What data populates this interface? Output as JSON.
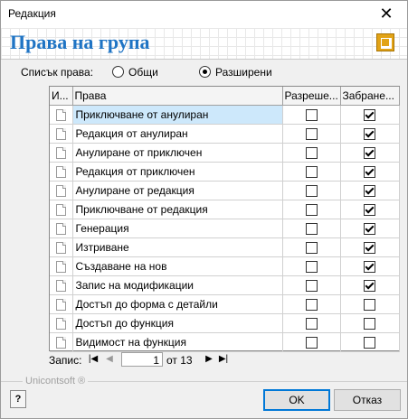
{
  "window": {
    "title": "Редакция",
    "close_glyph": "✕"
  },
  "header": {
    "title": "Права на група",
    "logo_icon": "app-logo-icon"
  },
  "rights_list": {
    "label": "Списък права:",
    "options": [
      {
        "label": "Общи",
        "selected": false
      },
      {
        "label": "Разширени",
        "selected": true
      }
    ]
  },
  "table": {
    "columns": [
      "И...",
      "Права",
      "Разреше...",
      "Забране..."
    ],
    "rows": [
      {
        "name": "Приключване от анулиран",
        "allowed": false,
        "denied": true,
        "selected": true
      },
      {
        "name": "Редакция от анулиран",
        "allowed": false,
        "denied": true,
        "selected": false
      },
      {
        "name": "Анулиране от приключен",
        "allowed": false,
        "denied": true,
        "selected": false
      },
      {
        "name": "Редакция от приключен",
        "allowed": false,
        "denied": true,
        "selected": false
      },
      {
        "name": "Анулиране от редакция",
        "allowed": false,
        "denied": true,
        "selected": false
      },
      {
        "name": "Приключване от редакция",
        "allowed": false,
        "denied": true,
        "selected": false
      },
      {
        "name": "Генерация",
        "allowed": false,
        "denied": true,
        "selected": false
      },
      {
        "name": "Изтриване",
        "allowed": false,
        "denied": true,
        "selected": false
      },
      {
        "name": "Създаване на нов",
        "allowed": false,
        "denied": true,
        "selected": false
      },
      {
        "name": "Запис на модификации",
        "allowed": false,
        "denied": true,
        "selected": false
      },
      {
        "name": "Достъп до форма с детайли",
        "allowed": false,
        "denied": false,
        "selected": false
      },
      {
        "name": "Достъп до функция",
        "allowed": false,
        "denied": false,
        "selected": false
      },
      {
        "name": "Видимост на функция",
        "allowed": false,
        "denied": false,
        "selected": false
      }
    ]
  },
  "navigator": {
    "label": "Запис:",
    "current": "1",
    "of_text": "от 13"
  },
  "footer": {
    "brand": "Unicontsoft ®",
    "help_label": "?",
    "ok_label": "OK",
    "cancel_label": "Отказ"
  }
}
